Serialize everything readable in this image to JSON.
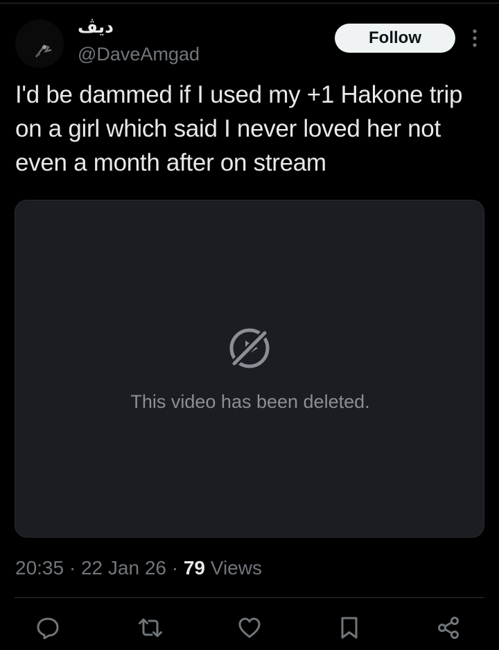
{
  "user": {
    "display_name": "ديڤ",
    "handle": "@DaveAmgad"
  },
  "follow_label": "Follow",
  "tweet": {
    "text": "I'd be dammed if I used my +1 Hakone trip on a girl which said I never loved her not even a month after on stream"
  },
  "media": {
    "deleted_message": "This video has been deleted."
  },
  "meta": {
    "time": "20:35",
    "sep1": " · ",
    "date": "22 Jan 26",
    "sep2": " · ",
    "views_count": "79",
    "views_label": " Views"
  },
  "icons": {
    "more": "more-vertical-icon",
    "deleted": "video-deleted-icon",
    "reply": "reply-icon",
    "retweet": "retweet-icon",
    "like": "heart-icon",
    "bookmark": "bookmark-icon",
    "share": "share-icon"
  },
  "colors": {
    "background": "#000000",
    "text": "#e7e9ea",
    "secondary": "#71767b",
    "media_bg": "#1c1d22",
    "follow_bg": "#eff3f4"
  }
}
